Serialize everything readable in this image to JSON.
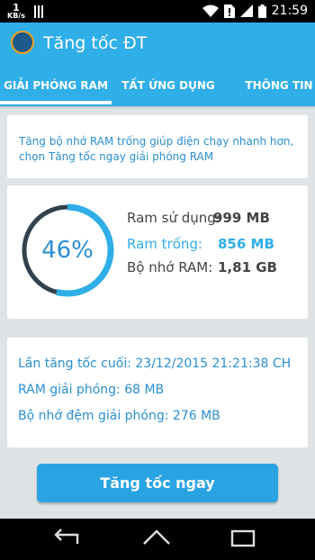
{
  "status_bar": {
    "speed_value": "1",
    "speed_unit": "KB/s",
    "time": "21:59"
  },
  "app_bar": {
    "title": "Tăng tốc ĐT"
  },
  "tabs": [
    {
      "label": "GIẢI PHÓNG RAM",
      "active": true
    },
    {
      "label": "TẤT ỨNG DỤNG",
      "active": false
    },
    {
      "label": "THÔNG TIN",
      "active": false
    }
  ],
  "description": "Tăng bộ nhớ RAM trống giúp điện chạy nhanh hơn, chọn Tăng tốc ngay giải phóng RAM",
  "ram": {
    "percent_text": "46%",
    "used_fraction": 0.46,
    "used_label": "Ram sử dụng:",
    "used_value": "999 MB",
    "free_label": "Ram trống:",
    "free_value": "856 MB",
    "total_label": "Bộ nhớ RAM:",
    "total_value": "1,81 GB"
  },
  "info": {
    "last_boost": "Lần tăng tốc cuối: 23/12/2015 21:21:38 CH",
    "ram_freed": "RAM giải phóng: 68 MB",
    "cache_freed": "Bộ nhớ đệm giải phóng: 276 MB"
  },
  "boost_button": "Tăng tốc ngay",
  "colors": {
    "accent": "#2faee8",
    "gauge_used": "#31424d",
    "gauge_free": "#2faee8",
    "text_blue": "#2a8fd3"
  }
}
